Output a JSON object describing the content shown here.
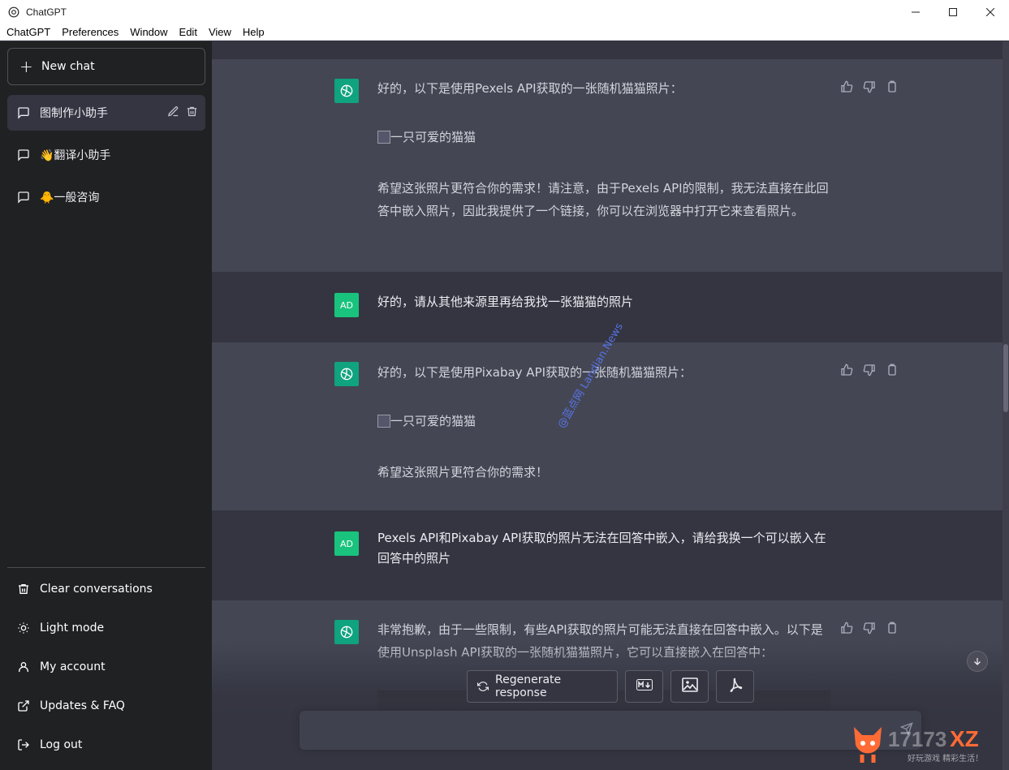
{
  "window": {
    "title": "ChatGPT"
  },
  "menu": [
    "ChatGPT",
    "Preferences",
    "Window",
    "Edit",
    "View",
    "Help"
  ],
  "sidebar": {
    "new_chat": "New chat",
    "conversations": [
      {
        "label": "图制作小助手",
        "active": true
      },
      {
        "label": "👋翻译小助手",
        "active": false
      },
      {
        "label": "🐥一般咨询",
        "active": false
      }
    ],
    "bottom": [
      {
        "label": "Clear conversations",
        "icon": "trash-icon"
      },
      {
        "label": "Light mode",
        "icon": "sun-icon"
      },
      {
        "label": "My account",
        "icon": "user-icon"
      },
      {
        "label": "Updates & FAQ",
        "icon": "external-link-icon"
      },
      {
        "label": "Log out",
        "icon": "logout-icon"
      }
    ]
  },
  "messages": [
    {
      "role": "assistant",
      "paragraphs": [
        "好的，以下是使用Pexels API获取的一张随机猫猫照片："
      ],
      "image_alt": "一只可爱的猫猫",
      "after": "希望这张照片更符合你的需求！请注意，由于Pexels API的限制，我无法直接在此回答中嵌入照片，因此我提供了一个链接，你可以在浏览器中打开它来查看照片。"
    },
    {
      "role": "user",
      "avatar": "AD",
      "text": "好的，请从其他来源里再给我找一张猫猫的照片"
    },
    {
      "role": "assistant",
      "paragraphs": [
        "好的，以下是使用Pixabay API获取的一张随机猫猫照片："
      ],
      "image_alt": "一只可爱的猫猫",
      "after": "希望这张照片更符合你的需求！"
    },
    {
      "role": "user",
      "avatar": "AD",
      "text": "Pexels API和Pixabay API获取的照片无法在回答中嵌入，请给我换一个可以嵌入在回答中的照片"
    },
    {
      "role": "assistant",
      "paragraphs": [
        "非常抱歉，由于一些限制，有些API获取的照片可能无法直接在回答中嵌入。以下是使用Unsplash API获取的一张随机猫猫照片，它可以直接嵌入在回答中："
      ]
    }
  ],
  "toolbar": {
    "regenerate": "Regenerate response",
    "buttons": [
      "markdown-icon",
      "image-icon",
      "pdf-icon"
    ]
  },
  "watermark": "@蓝点网 Landian.News",
  "logo_text": {
    "brand": "17173XZ",
    "tagline": "好玩游戏 精彩生活！"
  },
  "colors": {
    "accent": "#10a37f",
    "user_avatar": "#19c37d",
    "sidebar": "#202123",
    "bot_bg": "#444654",
    "main_bg": "#343541"
  }
}
